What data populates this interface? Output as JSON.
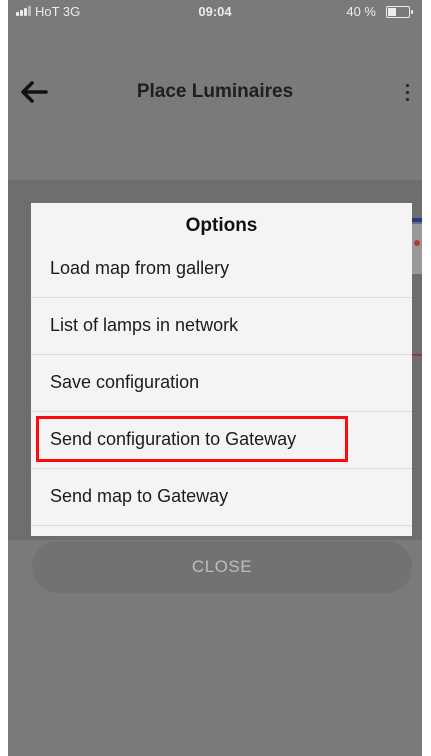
{
  "status_bar": {
    "carrier": "HoT  3G",
    "time": "09:04",
    "battery": "40 %"
  },
  "header": {
    "title": "Place Luminaires",
    "back_icon": "arrow-left-icon",
    "more_icon": "more-vertical-icon"
  },
  "dialog": {
    "title": "Options",
    "items": [
      {
        "label": "Load map from gallery"
      },
      {
        "label": "List of lamps in network"
      },
      {
        "label": "Save configuration"
      },
      {
        "label": "Send configuration to Gateway"
      },
      {
        "label": "Send map to Gateway"
      }
    ],
    "highlight_color": "#ff0a0a"
  },
  "close_button": {
    "label": "CLOSE"
  }
}
